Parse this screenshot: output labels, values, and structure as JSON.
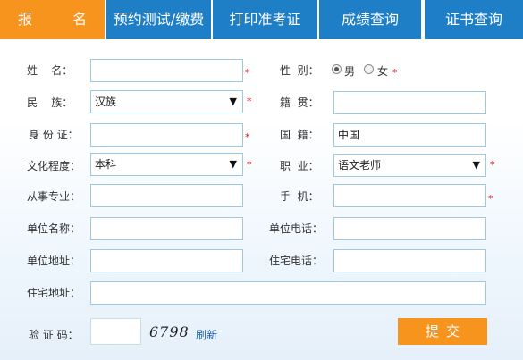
{
  "tabs": [
    {
      "label": "报  名",
      "active": true
    },
    {
      "label": "预约测试/缴费",
      "active": false
    },
    {
      "label": "打印准考证",
      "active": false
    },
    {
      "label": "成绩查询",
      "active": false
    },
    {
      "label": "证书查询",
      "active": false
    }
  ],
  "form": {
    "labels": {
      "name": "姓    名：",
      "gender": "性  别：",
      "ethnicity": "民    族：",
      "native_place": "籍  贯：",
      "id_card": "身 份 证：",
      "nationality": "国  籍：",
      "education": "文化程度：",
      "occupation": "职  业：",
      "major": "从事专业：",
      "mobile": "手  机：",
      "work_unit": "单位名称：",
      "work_phone": "单位电话：",
      "work_address": "单位地址：",
      "home_phone": "住宅电话：",
      "home_address": "住宅地址：",
      "captcha": "验 证 码："
    },
    "values": {
      "name": "",
      "ethnicity": "汉族",
      "native_place": "",
      "id_card": "",
      "nationality": "中国",
      "education": "本科",
      "occupation": "语文老师",
      "major": "",
      "mobile": "",
      "work_unit": "",
      "work_phone": "",
      "work_address": "",
      "home_phone": "",
      "home_address": "",
      "captcha_input": ""
    },
    "gender_options": {
      "male": "男",
      "female": "女",
      "selected": "male"
    },
    "required_mark": "*",
    "dropdown_arrow": "▼",
    "captcha_code": "6798",
    "refresh_label": "刷新",
    "submit_label": "提交"
  },
  "colors": {
    "active_tab": "#f7941d",
    "tab": "#1f7fc6",
    "input_border": "#9ec8e6",
    "required": "#e01010",
    "submit": "#f7941d",
    "link": "#1f5fa8"
  }
}
